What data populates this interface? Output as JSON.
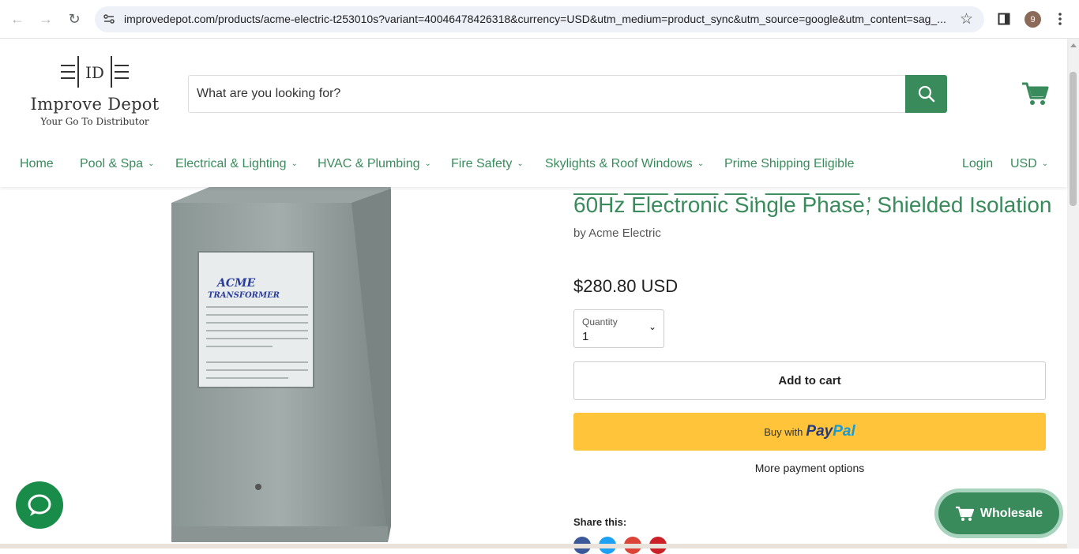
{
  "browser": {
    "url": "improvedepot.com/products/acme-electric-t253010s?variant=40046478426318&currency=USD&utm_medium=product_sync&utm_source=google&utm_content=sag_...",
    "profile_initial": "9"
  },
  "header": {
    "logo_mark": "ID",
    "logo_name": "Improve Depot",
    "logo_tagline": "Your Go To Distributor",
    "search_placeholder": "What are you looking for?"
  },
  "menu": {
    "items": [
      {
        "label": "Home",
        "has_dropdown": false
      },
      {
        "label": "Pool & Spa",
        "has_dropdown": true
      },
      {
        "label": "Electrical & Lighting",
        "has_dropdown": true
      },
      {
        "label": "HVAC & Plumbing",
        "has_dropdown": true
      },
      {
        "label": "Fire Safety",
        "has_dropdown": true
      },
      {
        "label": "Skylights & Roof Windows",
        "has_dropdown": true
      },
      {
        "label": "Prime Shipping Eligible",
        "has_dropdown": false
      }
    ],
    "login": "Login",
    "currency": "USD"
  },
  "product": {
    "title_line": "60Hz Electronic Single Phase, Shielded Isolation",
    "vendor": "by Acme Electric",
    "price": "$280.80 USD",
    "quantity_label": "Quantity",
    "quantity_value": "1",
    "add_to_cart": "Add to cart",
    "paypal_prefix": "Buy with",
    "paypal_brand_1": "Pay",
    "paypal_brand_2": "Pal",
    "more_payment": "More payment options",
    "share_label": "Share this:"
  },
  "widgets": {
    "wholesale": "Wholesale"
  },
  "colors": {
    "brand_green": "#3a8b5c",
    "paypal_yellow": "#ffc439"
  }
}
